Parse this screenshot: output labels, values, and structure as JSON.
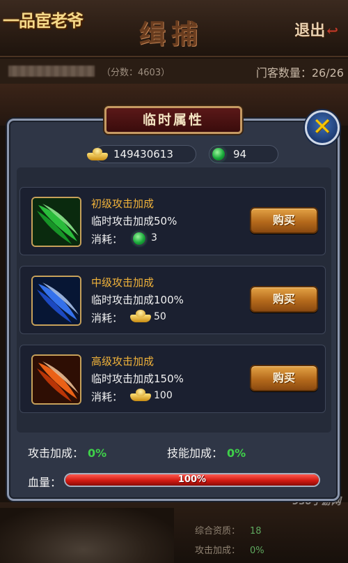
{
  "scene": {
    "logo": "一品宦老爷",
    "title": "缉捕",
    "exit_label": "退出",
    "score_text": "（分数：4603）",
    "guests_text": "门客数量：26/26",
    "bg_stats": [
      {
        "label": "综合资质：",
        "value": "18"
      },
      {
        "label": "攻击加成：",
        "value": "0%"
      }
    ],
    "watermark": "9s6手游网"
  },
  "dialog": {
    "title": "临时属性",
    "close_icon": "close-x-icon",
    "gold": "149430613",
    "jade": "94",
    "cost_label": "消耗：",
    "buy_label": "购买",
    "items": [
      {
        "name": "初级攻击加成",
        "desc": "临时攻击加成50%",
        "cost": "3",
        "currency": "jade-icon",
        "color": "#2ecc40"
      },
      {
        "name": "中级攻击加成",
        "desc": "临时攻击加成100%",
        "cost": "50",
        "currency": "gold-ingot-icon",
        "color": "#3a7bff"
      },
      {
        "name": "高级攻击加成",
        "desc": "临时攻击加成150%",
        "cost": "100",
        "currency": "gold-ingot-icon",
        "color": "#ff6a1a"
      }
    ],
    "attack_bonus_label": "攻击加成：",
    "attack_bonus_value": "0%",
    "skill_bonus_label": "技能加成：",
    "skill_bonus_value": "0%",
    "hp_label": "血量：",
    "hp_text": "100%",
    "hp_fraction": 1.0
  }
}
